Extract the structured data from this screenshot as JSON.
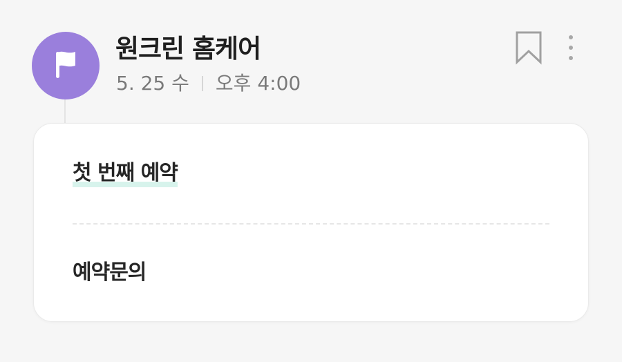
{
  "header": {
    "sender": "원크린 홈케어",
    "date": "5. 25 수",
    "time": "오후 4:00",
    "avatar_icon": "flag-icon",
    "avatar_color": "#9a7fdc"
  },
  "actions": {
    "bookmark_icon": "bookmark-icon",
    "more_icon": "more-vertical-icon"
  },
  "card": {
    "items": [
      {
        "label": "첫 번째 예약"
      },
      {
        "label": "예약문의"
      }
    ],
    "highlight_color": "#d7f3ec"
  }
}
